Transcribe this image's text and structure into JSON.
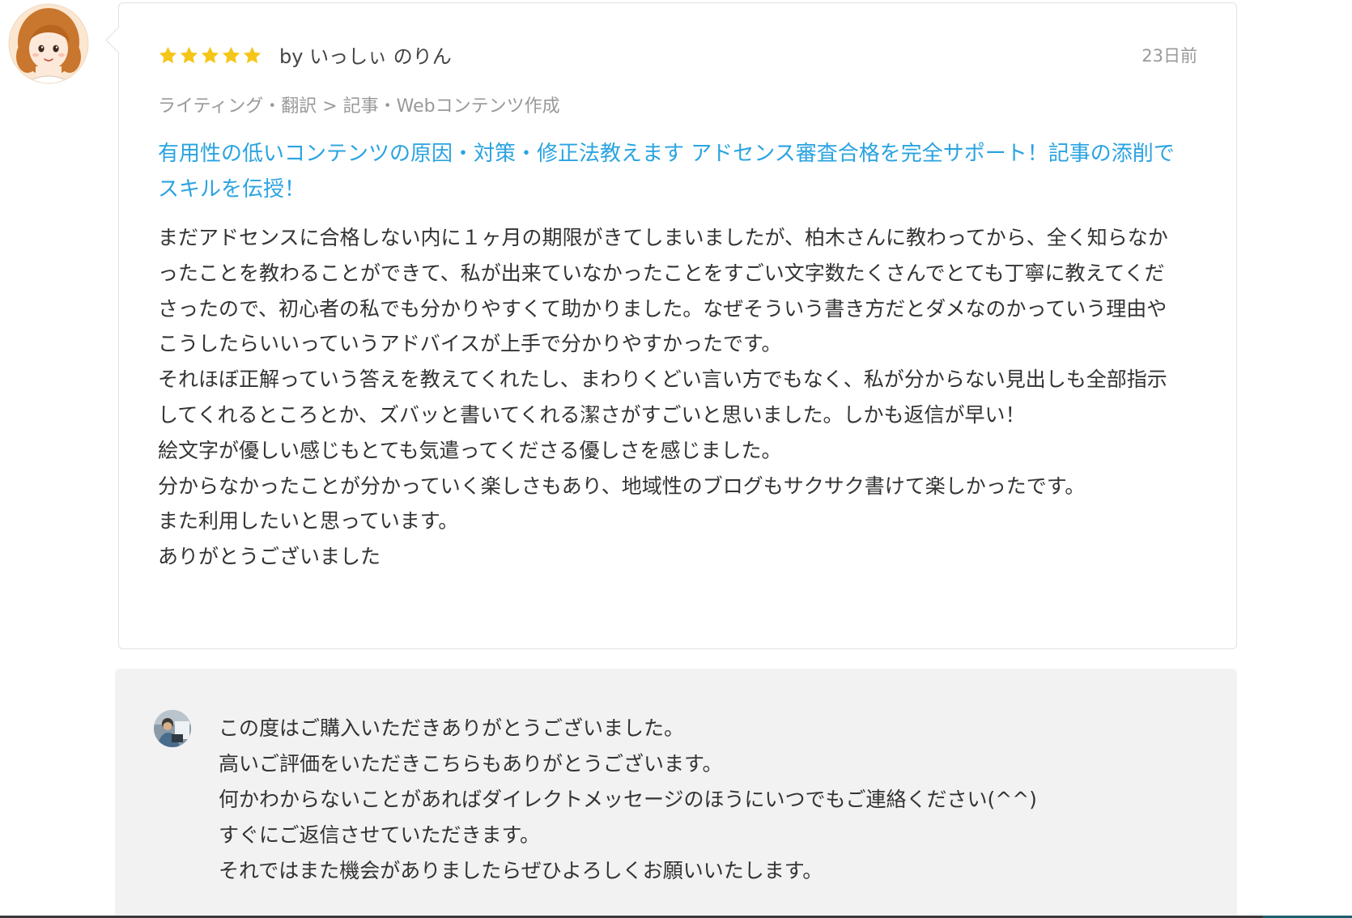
{
  "review": {
    "rating": 5,
    "stars_count_label": "5",
    "reviewer": "by いっしぃ のりん",
    "date": "23日前",
    "breadcrumb": "ライティング・翻訳 > 記事・Webコンテンツ作成",
    "service_title": "有用性の低いコンテンツの原因・対策・修正法教えます アドセンス審査合格を完全サポート！記事の添削でスキルを伝授！",
    "body": [
      "まだアドセンスに合格しない内に１ヶ月の期限がきてしまいましたが、柏木さんに教わってから、全く知らなかったことを教わることができて、私が出来ていなかったことをすごい文字数たくさんでとても丁寧に教えてくださったので、初心者の私でも分かりやすくて助かりました。なぜそういう書き方だとダメなのかっていう理由やこうしたらいいっていうアドバイスが上手で分かりやすかったです。",
      "それほぼ正解っていう答えを教えてくれたし、まわりくどい言い方でもなく、私が分からない見出しも全部指示してくれるところとか、ズバッと書いてくれる潔さがすごいと思いました。しかも返信が早い！",
      "絵文字が優しい感じもとても気遣ってくださる優しさを感じました。",
      "分からなかったことが分かっていく楽しさもあり、地域性のブログもサクサク書けて楽しかったです。",
      "また利用したいと思っています。",
      "ありがとうございました"
    ]
  },
  "reply": {
    "lines": [
      "この度はご購入いただきありがとうございました。",
      "高いご評価をいただきこちらもありがとうございます。",
      "何かわからないことがあればダイレクトメッセージのほうにいつでもご連絡ください(^^)",
      "すぐにご返信させていただきます。",
      "それではまた機会がありましたらぜひよろしくお願いいたします。"
    ]
  },
  "colors": {
    "link": "#2aa3e0",
    "star": "#f5c518",
    "muted_text": "#999999",
    "reply_background": "#f2f2f2"
  },
  "icons": {
    "reviewer_avatar": "illustrated-woman-avatar",
    "star": "star-icon",
    "reply_avatar": "seller-photo-avatar"
  }
}
